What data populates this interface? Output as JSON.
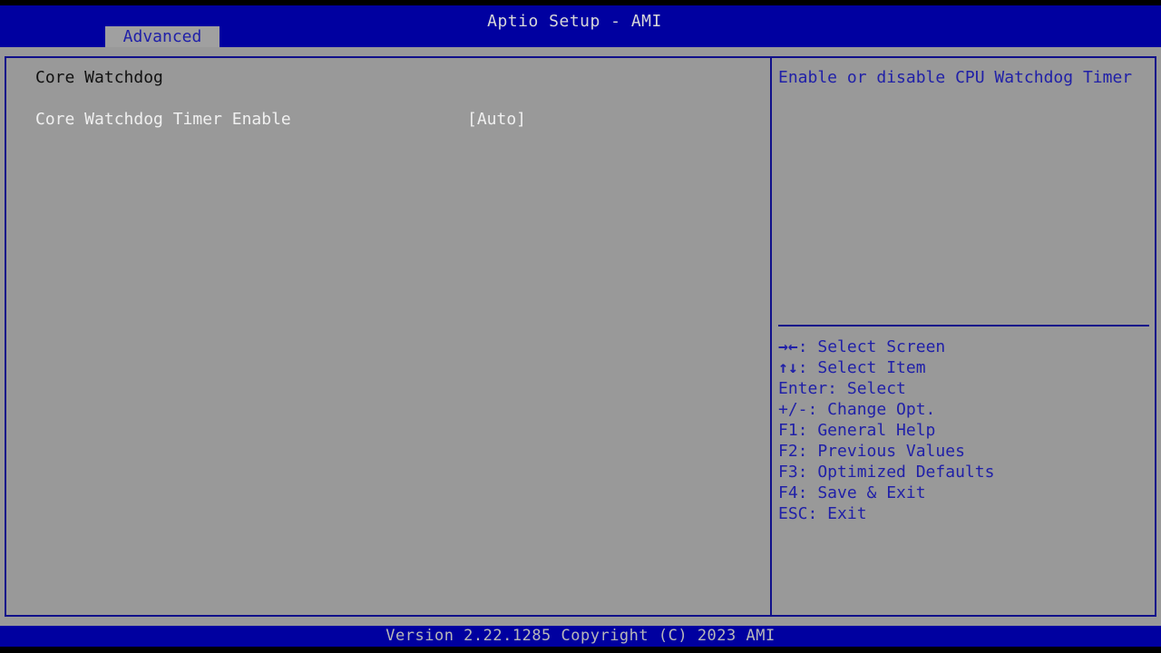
{
  "header": {
    "title": "Aptio Setup - AMI",
    "active_tab": "Advanced"
  },
  "main": {
    "section_title": "Core Watchdog",
    "items": [
      {
        "label": "Core Watchdog Timer Enable",
        "value": "[Auto]"
      }
    ]
  },
  "help": {
    "text": "Enable or disable CPU Watchdog Timer"
  },
  "keys": [
    {
      "icon": "left-right-arrows-icon",
      "glyph": "→←",
      "text": ": Select Screen"
    },
    {
      "icon": "up-down-arrows-icon",
      "glyph": "↑↓",
      "text": ": Select Item"
    },
    {
      "text": "Enter: Select"
    },
    {
      "text": "+/-: Change Opt."
    },
    {
      "text": "F1: General Help"
    },
    {
      "text": "F2: Previous Values"
    },
    {
      "text": "F3: Optimized Defaults"
    },
    {
      "text": "F4: Save & Exit"
    },
    {
      "text": "ESC: Exit"
    }
  ],
  "footer": {
    "text": "Version 2.22.1285 Copyright (C) 2023 AMI"
  },
  "colors": {
    "header_blue": "#0000a0",
    "body_gray": "#999999",
    "help_blue": "#2020a8",
    "selected_white": "#f0f0f0"
  }
}
